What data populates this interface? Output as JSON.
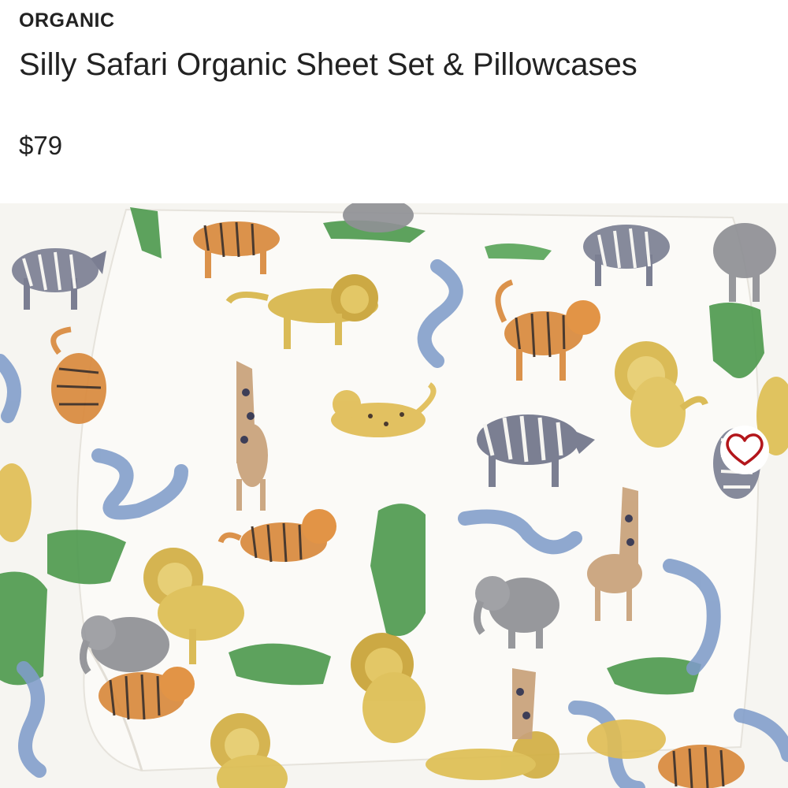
{
  "product": {
    "badge": "ORGANIC",
    "title": "Silly Safari Organic Sheet Set & Pillowcases",
    "price": "$79"
  },
  "image": {
    "alt": "Silly Safari organic sheet set with pillowcase featuring watercolor lions, tigers, zebras, giraffes, crocodiles, elephants, snakes and cheetahs",
    "palette": {
      "fabric": "#f7f6f2",
      "pillow": "#fbfaf7",
      "lion": "#d8b64a",
      "tiger": "#d98a3d",
      "zebra": "#6e7288",
      "crocodile": "#4f9a4f",
      "snake": "#7f9cc9",
      "elephant": "#8f9095",
      "giraffe": "#c9a27a",
      "cheetah": "#e0bd55"
    }
  },
  "favorite": {
    "icon": "heart-icon",
    "color": "#b3161b",
    "selected": false
  }
}
